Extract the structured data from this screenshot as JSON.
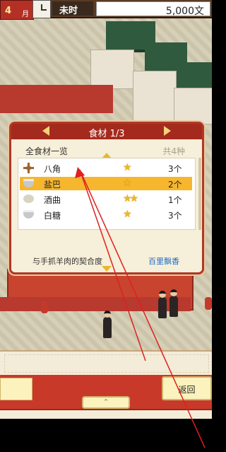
{
  "top_bar": {
    "month_number": "4",
    "month_unit": "月",
    "time_label": "未时",
    "money": "5,000文"
  },
  "dialog": {
    "title": "食材 1/3",
    "section_label": "全食材一览",
    "total_label": "共4种",
    "items": [
      {
        "name": "八角",
        "stars": "★",
        "count": "3个",
        "icon": "star-anise-icon",
        "selected": false
      },
      {
        "name": "盐巴",
        "stars": "★",
        "count": "2个",
        "icon": "salt-bowl-icon",
        "selected": true
      },
      {
        "name": "酒曲",
        "stars": "★★",
        "count": "1个",
        "icon": "wine-yeast-icon",
        "selected": false
      },
      {
        "name": "白糖",
        "stars": "★",
        "count": "3个",
        "icon": "sugar-bowl-icon",
        "selected": false
      }
    ],
    "compat_label": "与手抓羊肉的契合度",
    "compat_value": "百里飘香"
  },
  "bottom": {
    "back_label": "返回",
    "center_glyph": "⌃"
  },
  "colors": {
    "accent_red": "#a52a1e",
    "selection": "#f6b62e",
    "star": "#f0b81c",
    "compat_value": "#1a6cc6",
    "annotation": "#e02020"
  }
}
